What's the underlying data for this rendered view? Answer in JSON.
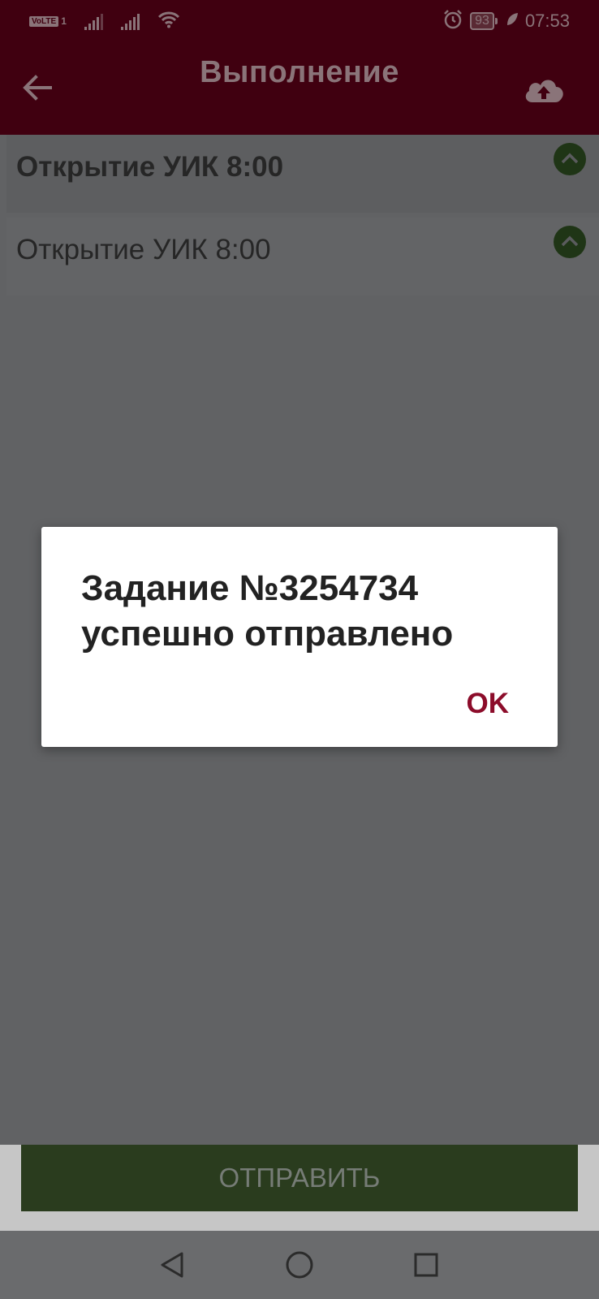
{
  "status_bar": {
    "network_tag": "VoLTE",
    "sim_slot": "1",
    "battery": "93",
    "time": "07:53",
    "icons": [
      "volte-icon",
      "signal-icon",
      "signal-icon",
      "wifi-icon",
      "alarm-icon",
      "battery-icon",
      "leaf-icon"
    ]
  },
  "app_bar": {
    "title": "Выполнение",
    "back_icon": "arrow-left-icon",
    "upload_icon": "cloud-upload-icon"
  },
  "tasks": [
    {
      "label": "Открытие УИК 8:00",
      "status_icon": "chevron-up-icon"
    },
    {
      "label": "Открытие УИК 8:00",
      "status_icon": "chevron-up-icon"
    }
  ],
  "send_button": {
    "label": "ОТПРАВИТЬ"
  },
  "dialog": {
    "message_line1": "Задание №3254734",
    "message_line2": "успешно отправлено",
    "ok_label": "OK"
  },
  "nav_bar": {
    "icons": [
      "back-triangle-icon",
      "home-circle-icon",
      "recents-square-icon"
    ]
  },
  "colors": {
    "app_bar": "#400010",
    "accent": "#8c0c2a",
    "chevron": "#1f3516",
    "send_button": "#2a3c1e",
    "scrim_content": "#616264"
  }
}
